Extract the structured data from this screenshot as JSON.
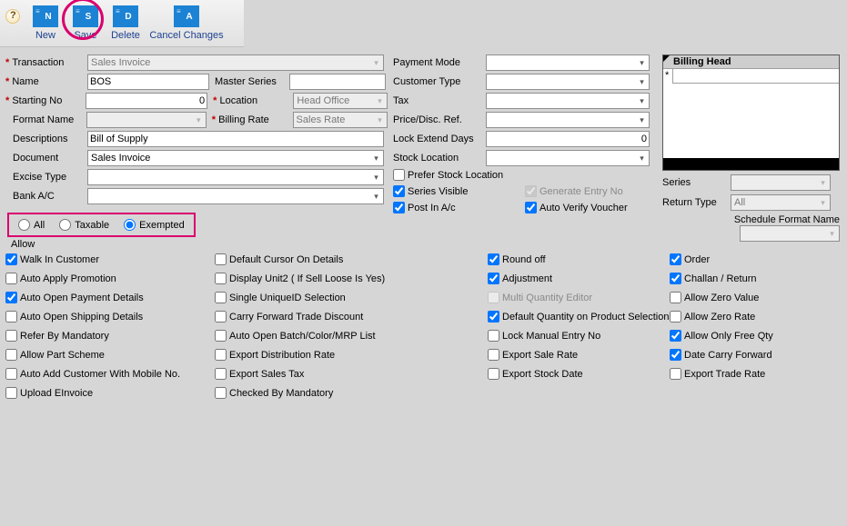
{
  "toolbar": {
    "new": "New",
    "save": "Save",
    "delete": "Delete",
    "cancel": "Cancel Changes",
    "iconN": "N",
    "iconS": "S",
    "iconD": "D",
    "iconA": "A"
  },
  "left": {
    "transaction_lbl": "Transaction",
    "transaction_val": "Sales Invoice",
    "name_lbl": "Name",
    "name_val": "BOS",
    "master_series_lbl": "Master Series",
    "master_series_val": "",
    "starting_no_lbl": "Starting No",
    "starting_no_val": "0",
    "location_lbl": "Location",
    "location_val": "Head Office",
    "format_name_lbl": "Format Name",
    "format_name_val": "",
    "billing_rate_lbl": "Billing Rate",
    "billing_rate_val": "Sales Rate",
    "descriptions_lbl": "Descriptions",
    "descriptions_val": "Bill of Supply",
    "document_lbl": "Document",
    "document_val": "Sales Invoice",
    "excise_type_lbl": "Excise Type",
    "excise_type_val": "",
    "bank_ac_lbl": "Bank A/C",
    "bank_ac_val": ""
  },
  "radios": {
    "all": "All",
    "taxable": "Taxable",
    "exempted": "Exempted"
  },
  "allow_lbl": "Allow",
  "mid": {
    "payment_mode_lbl": "Payment Mode",
    "payment_mode_val": "",
    "customer_type_lbl": "Customer Type",
    "customer_type_val": "",
    "tax_lbl": "Tax",
    "tax_val": "",
    "price_disc_lbl": "Price/Disc. Ref.",
    "price_disc_val": "",
    "lock_extend_lbl": "Lock Extend Days",
    "lock_extend_val": "0",
    "stock_location_lbl": "Stock Location",
    "stock_location_val": "",
    "prefer_stock": "Prefer Stock Location",
    "series_visible": "Series Visible",
    "generate_entry": "Generate Entry No",
    "post_in_ac": "Post In A/c",
    "auto_verify": "Auto Verify Voucher"
  },
  "right": {
    "billing_head": "Billing Head",
    "series_lbl": "Series",
    "return_type_lbl": "Return Type",
    "return_type_val": "All",
    "schedule_format_lbl": "Schedule Format Name"
  },
  "allow": {
    "c1": [
      "Walk In Customer",
      "Auto Apply Promotion",
      "Auto Open Payment Details",
      "Auto Open Shipping Details",
      "Refer By Mandatory",
      "Allow Part Scheme",
      "Auto Add Customer With Mobile No.",
      "Upload EInvoice"
    ],
    "c2": [
      "Default Cursor On Details",
      "Display Unit2 ( If Sell Loose Is Yes)",
      "Single UniqueID Selection",
      "Carry Forward Trade Discount",
      "Auto Open Batch/Color/MRP List",
      "Export Distribution Rate",
      "Export Sales Tax",
      "Checked By Mandatory"
    ],
    "c3": [
      "Round off",
      "Adjustment",
      "Multi Quantity Editor",
      "Default Quantity on Product Selection",
      "Lock Manual Entry No",
      "Export Sale Rate",
      "Export Stock Date"
    ],
    "c4": [
      "Order",
      "Challan / Return",
      "Allow Zero Value",
      "Allow Zero Rate",
      "Allow Only Free Qty",
      "Date Carry Forward",
      "Export Trade Rate"
    ]
  },
  "allow_checked": {
    "c1": [
      true,
      false,
      true,
      false,
      false,
      false,
      false,
      false
    ],
    "c2": [
      false,
      false,
      false,
      false,
      false,
      false,
      false,
      false
    ],
    "c3": [
      true,
      true,
      false,
      true,
      false,
      false,
      false
    ],
    "c4": [
      true,
      true,
      false,
      false,
      true,
      true,
      false
    ]
  },
  "allow_disabled": {
    "c3_index": 2
  }
}
